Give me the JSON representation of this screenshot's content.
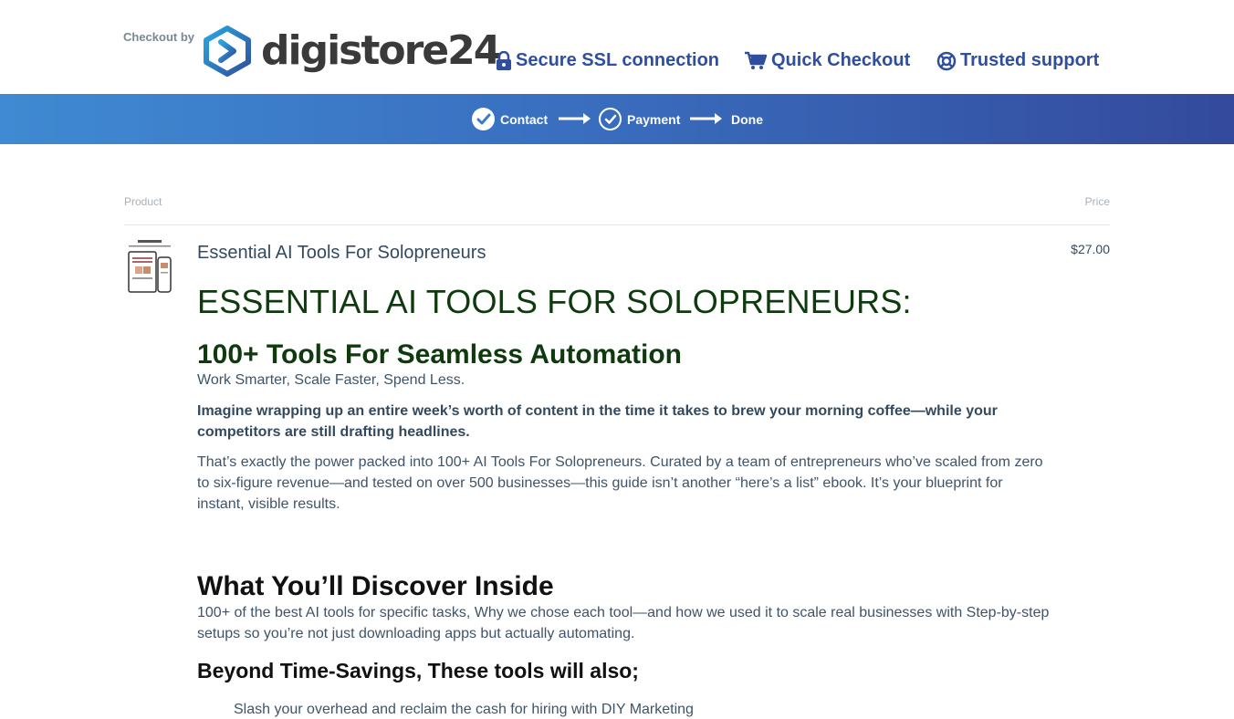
{
  "header": {
    "checkout_by": "Checkout by",
    "logo_text": "digistore24",
    "trust_ssl": "Secure SSL connection",
    "trust_quick": "Quick Checkout",
    "trust_support": "Trusted support"
  },
  "steps": {
    "contact": "Contact",
    "payment": "Payment",
    "done": "Done"
  },
  "table": {
    "product_header": "Product",
    "price_header": "Price"
  },
  "product": {
    "name": "Essential AI Tools For Solopreneurs",
    "price": "$27.00",
    "headline": "ESSENTIAL AI TOOLS FOR SOLOPRENEURS:",
    "subheadline": "100+ Tools For Seamless Automation",
    "tagline": "Work Smarter, Scale Faster, Spend Less.",
    "hook": "Imagine wrapping up an entire week’s worth of content in the time it takes to brew your morning coffee—while your competitors are still drafting headlines.",
    "body": "That’s exactly the power packed into 100+ AI Tools For Solopreneurs. Curated by a team of entrepreneurs who’ve scaled from zero to six-figure revenue—and tested on over 500 businesses—this guide isn’t another “here’s a list” ebook. It’s your blueprint for instant, visible results.",
    "discover_heading": "What You’ll Discover Inside",
    "discover_body": "100+ of the best AI tools for specific tasks, Why we chose each tool—and how we used it to scale real businesses with Step-by-step setups so you’re not just downloading apps but actually automating.",
    "beyond_heading": "Beyond Time-Savings, These tools will also;",
    "list_first_item": "Slash your overhead and reclaim the cash for hiring with DIY Marketing"
  },
  "colors": {
    "brand_blue": "#2f4f9e",
    "bar_start": "#3f8ad2",
    "bar_end": "#344a9c",
    "headline_green": "#0e3a0e"
  }
}
